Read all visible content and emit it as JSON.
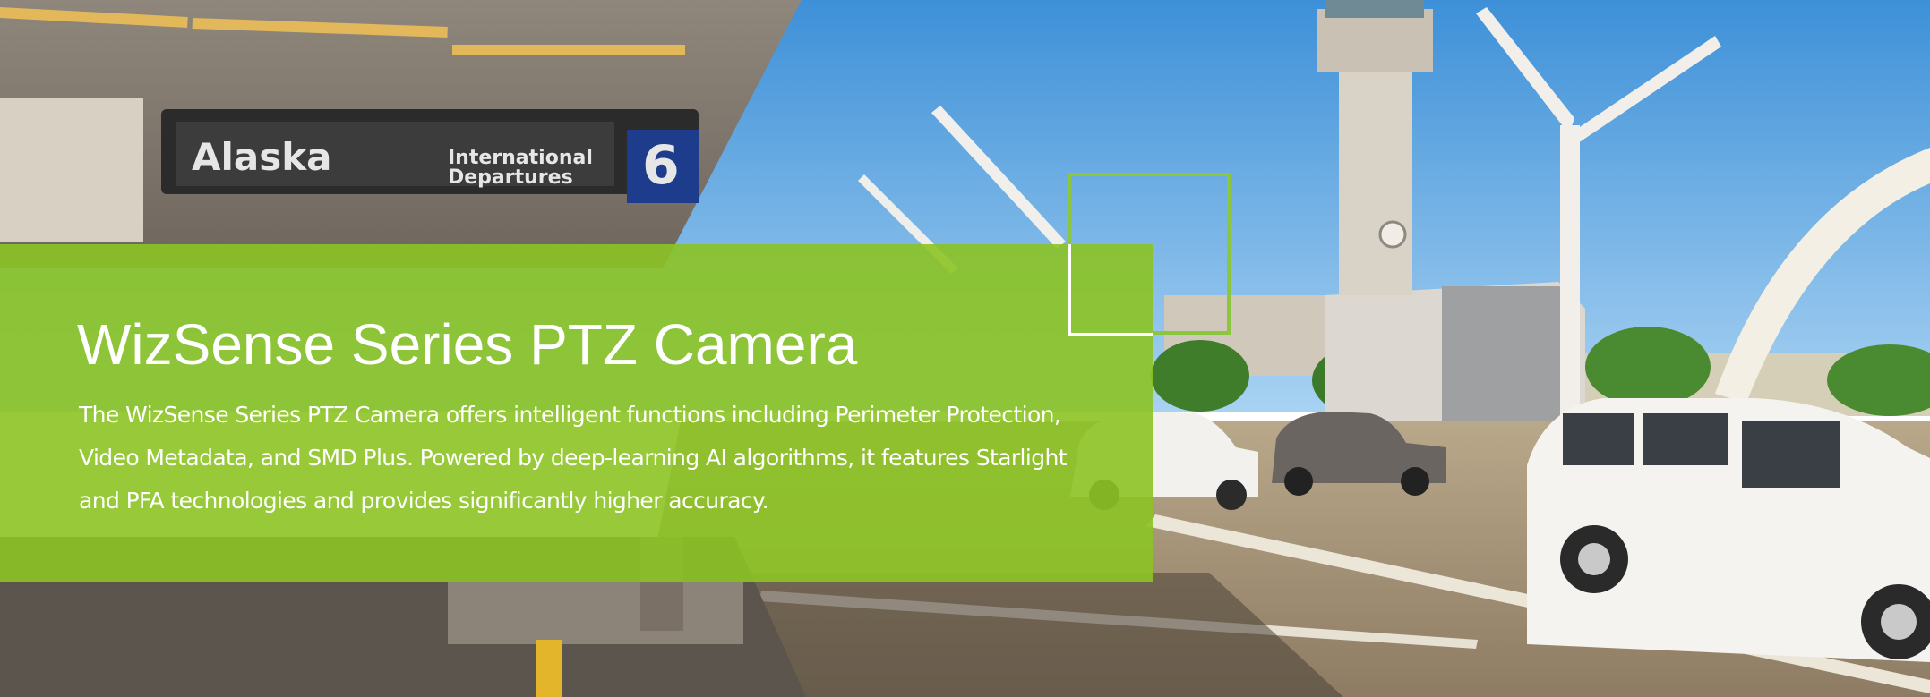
{
  "hero": {
    "title": "WizSense Series PTZ Camera",
    "description": "The WizSense Series PTZ Camera offers intelligent functions including Perimeter Protection, Video Metadata, and SMD Plus. Powered by deep-learning AI algorithms, it features Starlight and PFA technologies and provides significantly higher accuracy.",
    "accent_color": "#8cc63f",
    "text_color": "#ffffff"
  },
  "background": {
    "terminal_sign": {
      "airline": "Alaska",
      "line1": "International",
      "line2": "Departures",
      "terminal_number": "6"
    }
  }
}
